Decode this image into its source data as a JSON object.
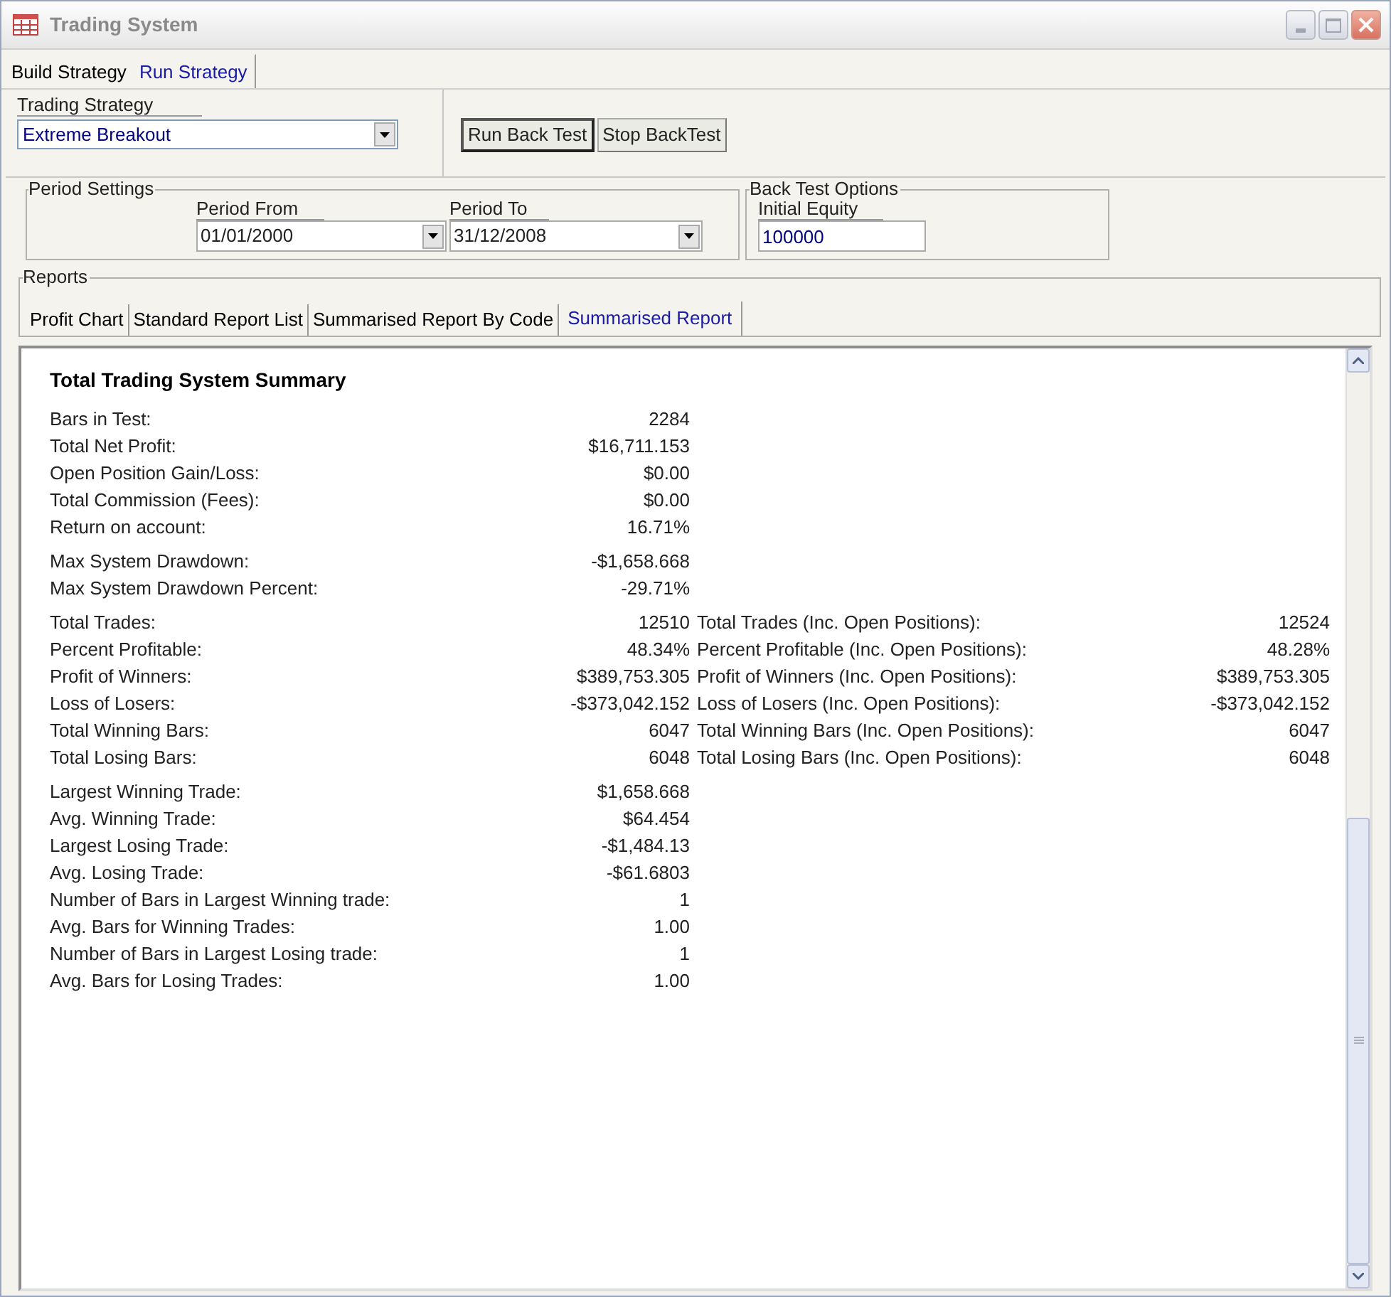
{
  "window": {
    "title": "Trading System"
  },
  "tabs": [
    {
      "label": "Build Strategy",
      "selected": false
    },
    {
      "label": "Run Strategy",
      "selected": true
    }
  ],
  "strategy": {
    "label": "Trading Strategy",
    "value": "Extreme Breakout"
  },
  "buttons": [
    "Run Back Test",
    "Stop BackTest"
  ],
  "period_settings": {
    "title": "Period Settings",
    "from_label": "Period From",
    "from_value": "01/01/2000",
    "to_label": "Period To",
    "to_value": "31/12/2008"
  },
  "back_test_options": {
    "title": "Back Test Options",
    "equity_label": "Initial Equity",
    "equity_value": "100000"
  },
  "reports": {
    "title": "Reports",
    "tabs": [
      {
        "label": "Profit Chart",
        "selected": false
      },
      {
        "label": "Standard Report List",
        "selected": false
      },
      {
        "label": "Summarised Report By Code",
        "selected": false
      },
      {
        "label": "Summarised Report",
        "selected": true
      }
    ]
  },
  "report": {
    "title": "Total Trading System Summary",
    "sections": [
      {
        "rows": [
          {
            "label": "Bars in Test:",
            "value": "2284"
          },
          {
            "label": "Total Net Profit:",
            "value": "$16,711.153"
          },
          {
            "label": "Open Position Gain/Loss:",
            "value": "$0.00"
          },
          {
            "label": "Total Commission (Fees):",
            "value": "$0.00"
          },
          {
            "label": "Return on account:",
            "value": "16.71%"
          }
        ]
      },
      {
        "rows": [
          {
            "label": "Max System Drawdown:",
            "value": "-$1,658.668"
          },
          {
            "label": "Max System Drawdown Percent:",
            "value": "-29.71%"
          }
        ]
      },
      {
        "rows": [
          {
            "label": "Total Trades:",
            "value": "12510",
            "label_2": "Total Trades (Inc. Open Positions):",
            "value_2": "12524"
          },
          {
            "label": "Percent Profitable:",
            "value": "48.34%",
            "label_2": "Percent Profitable (Inc. Open Positions):",
            "value_2": "48.28%"
          },
          {
            "label": "Profit of Winners:",
            "value": "$389,753.305",
            "label_2": "Profit of Winners (Inc. Open Positions):",
            "value_2": "$389,753.305"
          },
          {
            "label": "Loss of Losers:",
            "value": "-$373,042.152",
            "label_2": "Loss of Losers (Inc. Open Positions):",
            "value_2": "-$373,042.152"
          },
          {
            "label": "Total Winning Bars:",
            "value": "6047",
            "label_2": "Total Winning Bars (Inc. Open Positions):",
            "value_2": "6047"
          },
          {
            "label": "Total Losing Bars:",
            "value": "6048",
            "label_2": "Total Losing Bars (Inc. Open Positions):",
            "value_2": "6048"
          }
        ]
      },
      {
        "rows": [
          {
            "label": "Largest Winning Trade:",
            "value": "$1,658.668"
          },
          {
            "label": "Avg. Winning Trade:",
            "value": "$64.454"
          },
          {
            "label": "Largest Losing Trade:",
            "value": "-$1,484.13"
          },
          {
            "label": "Avg. Losing Trade:",
            "value": "-$61.6803"
          },
          {
            "label": "Number of Bars in Largest Winning trade:",
            "value": "1"
          },
          {
            "label": "Avg. Bars for Winning Trades:",
            "value": "1.00"
          },
          {
            "label": "Number of Bars in Largest Losing trade:",
            "value": "1"
          },
          {
            "label": "Avg. Bars for Losing Trades:",
            "value": "1.00"
          }
        ]
      }
    ]
  }
}
